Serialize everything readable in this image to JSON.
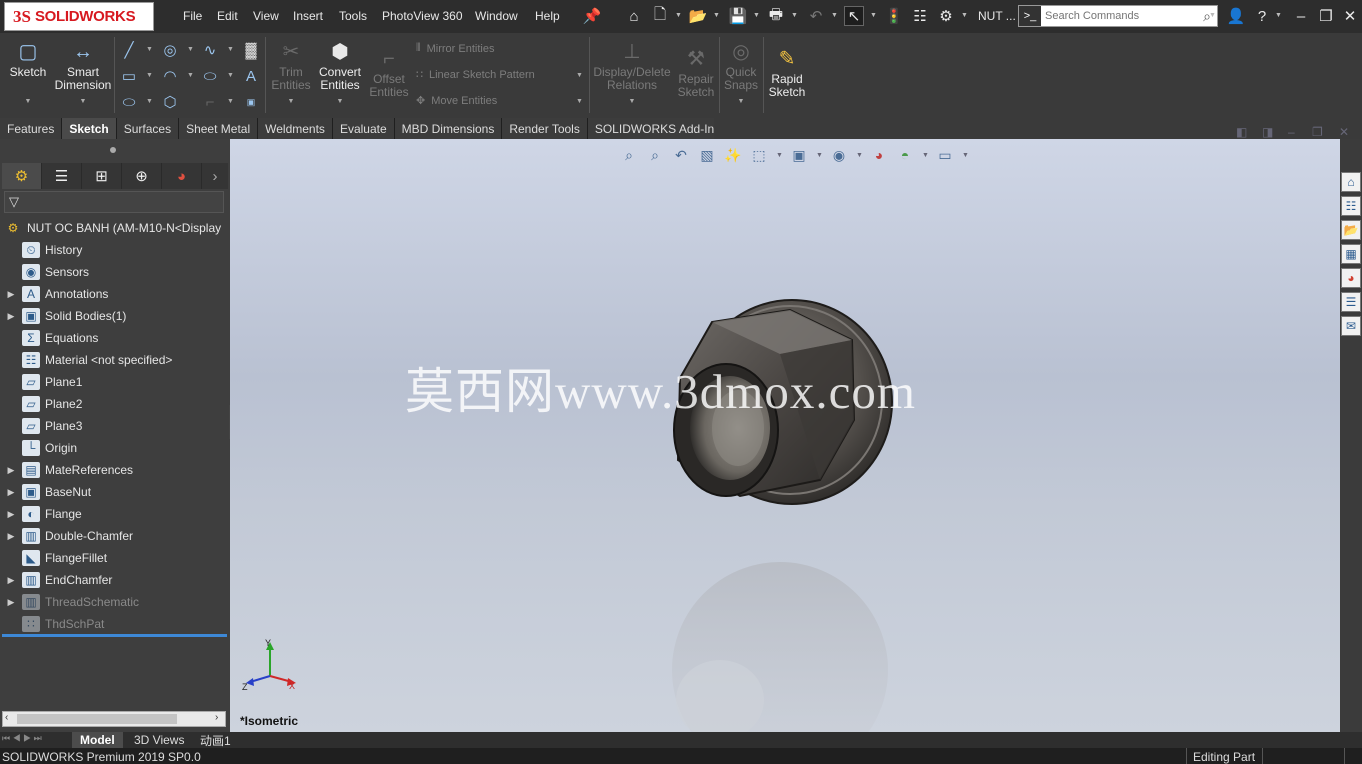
{
  "app": {
    "brand_prefix": "3S",
    "brand_name": "SOLIDWORKS"
  },
  "menu": [
    "File",
    "Edit",
    "View",
    "Insert",
    "Tools",
    "PhotoView 360",
    "Window",
    "Help"
  ],
  "titlebar": {
    "doc_title": "NUT ...",
    "search_placeholder": "Search Commands"
  },
  "commands": {
    "sketch": "Sketch",
    "smart_dimension_1": "Smart",
    "smart_dimension_2": "Dimension",
    "trim_1": "Trim",
    "trim_2": "Entities",
    "convert_1": "Convert",
    "convert_2": "Entities",
    "offset_1": "Offset",
    "offset_2": "Entities",
    "mirror": "Mirror Entities",
    "linear_pattern": "Linear Sketch Pattern",
    "move": "Move Entities",
    "display_delete_1": "Display/Delete",
    "display_delete_2": "Relations",
    "repair_1": "Repair",
    "repair_2": "Sketch",
    "quick_snaps_1": "Quick",
    "quick_snaps_2": "Snaps",
    "rapid_1": "Rapid",
    "rapid_2": "Sketch"
  },
  "tabs": [
    "Features",
    "Sketch",
    "Surfaces",
    "Sheet Metal",
    "Weldments",
    "Evaluate",
    "MBD Dimensions",
    "Render Tools",
    "SOLIDWORKS Add-Ins"
  ],
  "active_tab": "Sketch",
  "tree": {
    "root": "NUT OC BANH  (AM-M10-N<Display",
    "items": [
      {
        "label": "History",
        "icon": "history-icon",
        "expand": false,
        "dim": false
      },
      {
        "label": "Sensors",
        "icon": "sensors-icon",
        "expand": false,
        "dim": false
      },
      {
        "label": "Annotations",
        "icon": "annotations-icon",
        "expand": true,
        "dim": false
      },
      {
        "label": "Solid Bodies(1)",
        "icon": "solid-bodies-icon",
        "expand": true,
        "dim": false
      },
      {
        "label": "Equations",
        "icon": "equations-icon",
        "expand": false,
        "dim": false
      },
      {
        "label": "Material <not specified>",
        "icon": "material-icon",
        "expand": false,
        "dim": false
      },
      {
        "label": "Plane1",
        "icon": "plane-icon",
        "expand": false,
        "dim": false
      },
      {
        "label": "Plane2",
        "icon": "plane-icon",
        "expand": false,
        "dim": false
      },
      {
        "label": "Plane3",
        "icon": "plane-icon",
        "expand": false,
        "dim": false
      },
      {
        "label": "Origin",
        "icon": "origin-icon",
        "expand": false,
        "dim": false
      },
      {
        "label": "MateReferences",
        "icon": "folder-icon",
        "expand": true,
        "dim": false
      },
      {
        "label": "BaseNut",
        "icon": "extrude-icon",
        "expand": true,
        "dim": false
      },
      {
        "label": "Flange",
        "icon": "revolve-icon",
        "expand": true,
        "dim": false
      },
      {
        "label": "Double-Chamfer",
        "icon": "cut-icon",
        "expand": true,
        "dim": false
      },
      {
        "label": "FlangeFillet",
        "icon": "fillet-icon",
        "expand": false,
        "dim": false
      },
      {
        "label": "EndChamfer",
        "icon": "cut-icon",
        "expand": true,
        "dim": false
      },
      {
        "label": "ThreadSchematic",
        "icon": "cut-icon",
        "expand": true,
        "dim": true
      },
      {
        "label": "ThdSchPat",
        "icon": "pattern-icon",
        "expand": false,
        "dim": true
      }
    ]
  },
  "viewport": {
    "watermark": "莫西网www.3dmox.com",
    "view_name": "*Isometric",
    "triad_x": "X",
    "triad_y": "Y",
    "triad_z": "Z"
  },
  "bottom_tabs": [
    "Model",
    "3D Views",
    "动画1"
  ],
  "status": {
    "left": "SOLIDWORKS Premium 2019 SP0.0",
    "mode": "Editing Part"
  },
  "colors": {
    "accent": "#3d88d6",
    "brand_red": "#d71920"
  }
}
